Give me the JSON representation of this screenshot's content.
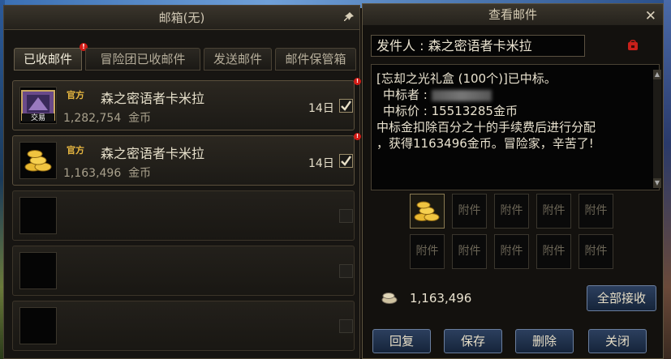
{
  "mailbox": {
    "title": "邮箱(无)",
    "tabs": [
      {
        "label": "已收邮件"
      },
      {
        "label": "冒险团已收邮件"
      },
      {
        "label": "发送邮件"
      },
      {
        "label": "邮件保管箱"
      }
    ],
    "mails": [
      {
        "badge": "官方",
        "sender": "森之密语者卡米拉",
        "amount": "1,282,754",
        "currency": "金币",
        "days": "14日",
        "item_label": "交易"
      },
      {
        "badge": "官方",
        "sender": "森之密语者卡米拉",
        "amount": "1,163,496",
        "currency": "金币",
        "days": "14日"
      }
    ]
  },
  "view_mail": {
    "title": "查看邮件",
    "sender_label": "发件人 : 森之密语者卡米拉",
    "content": [
      "[忘却之光礼盒 (100个)]已中标。",
      "中标者 :",
      "中标价 : 15513285金币",
      "中标金扣除百分之十的手续费后进行分配",
      "，获得1163496金币。冒险家，辛苦了!"
    ],
    "attachment_label": "附件",
    "gold_amount": "1,163,496",
    "receive_all": "全部接收",
    "buttons": {
      "reply": "回复",
      "save": "保存",
      "delete": "删除",
      "close": "关闭"
    }
  },
  "colors": {
    "alert": "#d21b16",
    "gold": "#e6b640",
    "button_blue": "#2c3f5e"
  }
}
